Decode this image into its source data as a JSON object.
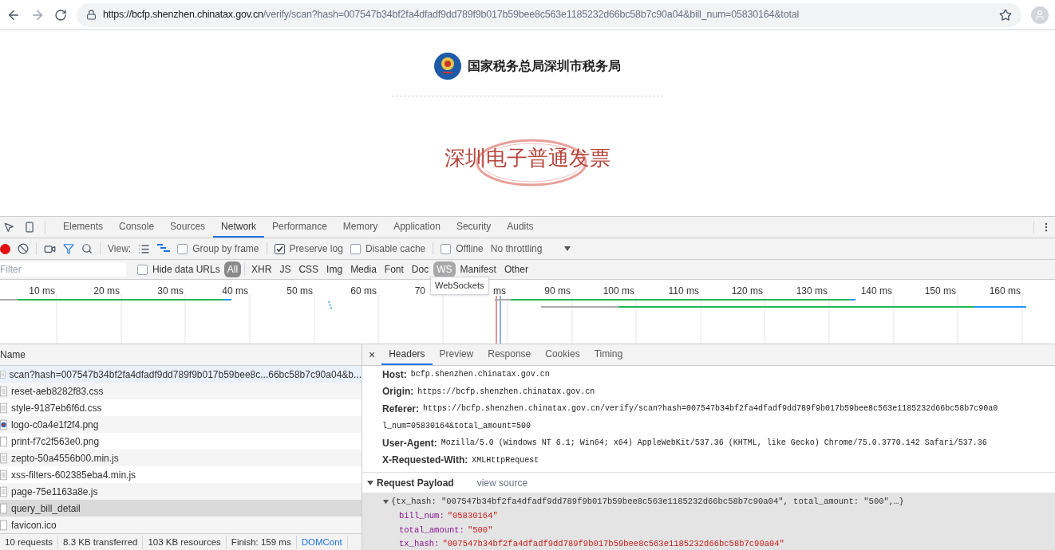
{
  "browser": {
    "url_host": "https://bcfp.shenzhen.chinatax.gov.cn",
    "url_rest": "/verify/scan?hash=007547b34bf2fa4dfadf9dd789f9b017b59bee8c563e1185232d66bc58b7c90a04&bill_num=05830164&total"
  },
  "page": {
    "agency": "国家税务总局深圳市税务局",
    "title": "深圳电子普通发票"
  },
  "devtools": {
    "tabs": [
      {
        "label": "Elements",
        "selected": false
      },
      {
        "label": "Console",
        "selected": false
      },
      {
        "label": "Sources",
        "selected": false
      },
      {
        "label": "Network",
        "selected": true
      },
      {
        "label": "Performance",
        "selected": false
      },
      {
        "label": "Memory",
        "selected": false
      },
      {
        "label": "Application",
        "selected": false
      },
      {
        "label": "Security",
        "selected": false
      },
      {
        "label": "Audits",
        "selected": false
      }
    ],
    "toolbar": {
      "recording": true,
      "filter_on": true,
      "view_label": "View:",
      "large_rows": false,
      "waterfall": true,
      "checkboxes": [
        {
          "label": "Group by frame",
          "checked": false
        },
        {
          "label": "Preserve log",
          "checked": true
        },
        {
          "label": "Disable cache",
          "checked": false
        },
        {
          "label": "Offline",
          "checked": false
        }
      ],
      "throttling": "No throttling"
    },
    "filter": {
      "placeholder": "Filter",
      "hide_data_urls": {
        "label": "Hide data URLs",
        "checked": false
      },
      "types": [
        {
          "label": "All",
          "selected": true,
          "hovered": false
        },
        {
          "label": "XHR",
          "selected": false,
          "hovered": false
        },
        {
          "label": "JS",
          "selected": false,
          "hovered": false
        },
        {
          "label": "CSS",
          "selected": false,
          "hovered": false
        },
        {
          "label": "Img",
          "selected": false,
          "hovered": false
        },
        {
          "label": "Media",
          "selected": false,
          "hovered": false
        },
        {
          "label": "Font",
          "selected": false,
          "hovered": false
        },
        {
          "label": "Doc",
          "selected": false,
          "hovered": false
        },
        {
          "label": "WS",
          "selected": false,
          "hovered": true
        },
        {
          "label": "Manifest",
          "selected": false,
          "hovered": false
        },
        {
          "label": "Other",
          "selected": false,
          "hovered": false
        }
      ],
      "tooltip": "WebSockets"
    },
    "timeline": {
      "ticks": [
        "10 ms",
        "20 ms",
        "30 ms",
        "40 ms",
        "50 ms",
        "60 ms",
        "70",
        "ms",
        "90 ms",
        "100 ms",
        "110 ms",
        "120 ms",
        "130 ms",
        "140 ms",
        "150 ms",
        "160 ms"
      ]
    },
    "requests": {
      "column": "Name",
      "rows": [
        {
          "name": "scan?hash=007547b34bf2fa4dfadf9dd789f9b017b59bee8c...66bc58b7c90a04&b...",
          "kind": "document",
          "selected": false,
          "hovered": true
        },
        {
          "name": "reset-aeb8282f83.css",
          "kind": "document",
          "selected": false,
          "hovered": false
        },
        {
          "name": "style-9187eb6f6d.css",
          "kind": "document",
          "selected": false,
          "hovered": false
        },
        {
          "name": "logo-c0a4e1f2f4.png",
          "kind": "image",
          "selected": false,
          "hovered": false
        },
        {
          "name": "print-f7c2f563e0.png",
          "kind": "blank",
          "selected": false,
          "hovered": false
        },
        {
          "name": "zepto-50a4556b00.min.js",
          "kind": "document",
          "selected": false,
          "hovered": false
        },
        {
          "name": "xss-filters-602385eba4.min.js",
          "kind": "document",
          "selected": false,
          "hovered": false
        },
        {
          "name": "page-75e1163a8e.js",
          "kind": "document",
          "selected": false,
          "hovered": false
        },
        {
          "name": "query_bill_detail",
          "kind": "blank",
          "selected": true,
          "hovered": false
        },
        {
          "name": "favicon.ico",
          "kind": "blank",
          "selected": false,
          "hovered": false
        }
      ],
      "status": [
        {
          "text": "10 requests",
          "kind": "plain"
        },
        {
          "text": "8.3 KB transferred",
          "kind": "plain"
        },
        {
          "text": "103 KB resources",
          "kind": "plain"
        },
        {
          "text": "Finish: 159 ms",
          "kind": "plain"
        },
        {
          "text": "DOMCont",
          "kind": "link"
        }
      ]
    },
    "details": {
      "close": "×",
      "tabs": [
        {
          "label": "Headers",
          "selected": true
        },
        {
          "label": "Preview",
          "selected": false
        },
        {
          "label": "Response",
          "selected": false
        },
        {
          "label": "Cookies",
          "selected": false
        },
        {
          "label": "Timing",
          "selected": false
        }
      ],
      "headers": [
        {
          "name": "Host:",
          "value": "bcfp.shenzhen.chinatax.gov.cn"
        },
        {
          "name": "Origin:",
          "value": "https://bcfp.shenzhen.chinatax.gov.cn"
        },
        {
          "name": "Referer:",
          "value": "https://bcfp.shenzhen.chinatax.gov.cn/verify/scan?hash=007547b34bf2fa4dfadf9dd789f9b017b59bee8c563e1185232d66bc58b7c90a0",
          "continuation": "l_num=05830164&total_amount=500"
        },
        {
          "name": "User-Agent:",
          "value": "Mozilla/5.0 (Windows NT 6.1; Win64; x64) AppleWebKit/537.36 (KHTML, like Gecko) Chrome/75.0.3770.142 Safari/537.36"
        },
        {
          "name": "X-Requested-With:",
          "value": "XMLHttpRequest"
        }
      ],
      "payload": {
        "title": "Request Payload",
        "expanded": true,
        "view_source": "view source",
        "summary": "{tx_hash: \"007547b34bf2fa4dfadf9dd789f9b017b59bee8c563e1185232d66bc58b7c90a04\", total_amount: \"500\",…}",
        "fields": [
          {
            "key": "bill_num:",
            "value": "\"05830164\""
          },
          {
            "key": "total_amount:",
            "value": "\"500\""
          },
          {
            "key": "tx_hash:",
            "value": "\"007547b34bf2fa4dfadf9dd789f9b017b59bee8c563e1185232d66bc58b7c90a04\""
          }
        ]
      }
    }
  }
}
